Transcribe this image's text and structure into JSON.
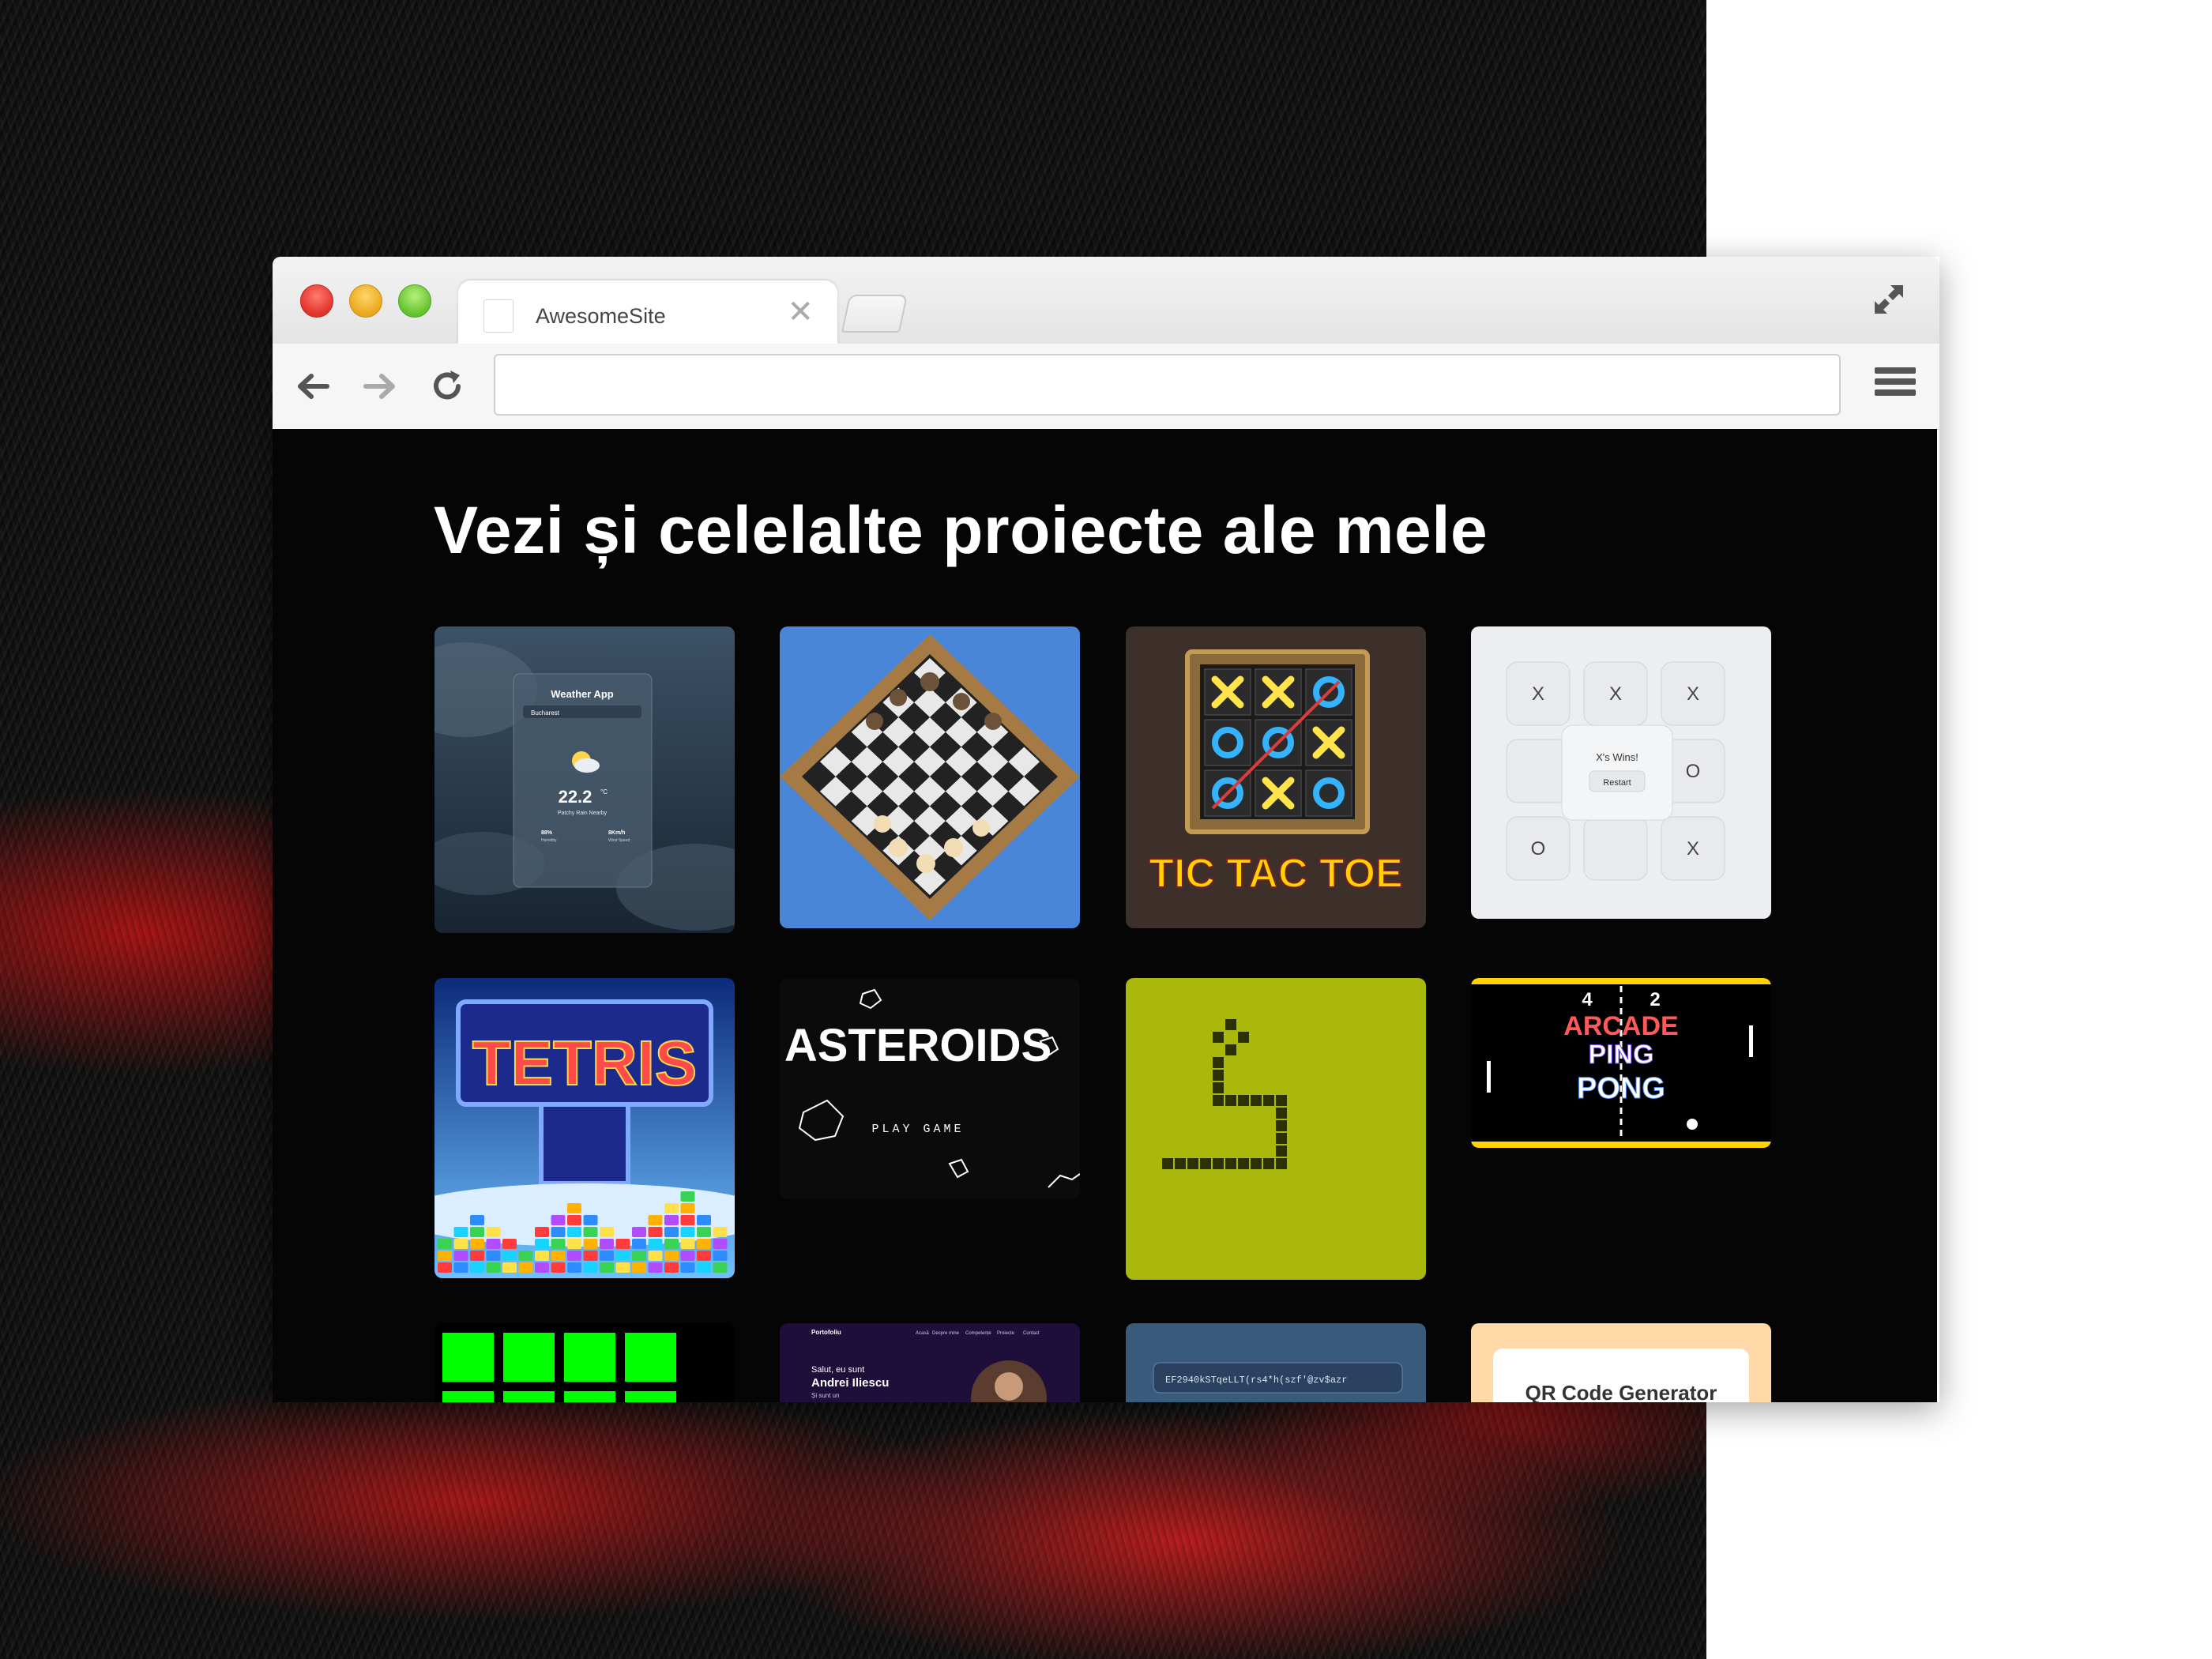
{
  "browser": {
    "tab_title": "AwesomeSite",
    "tab_close": "✕",
    "address_value": "",
    "address_placeholder": ""
  },
  "page": {
    "heading": "Vezi și celelalte proiecte ale mele"
  },
  "projects": [
    {
      "id": "weather",
      "icon": "weather-app-thumbnail",
      "title": "Weather App",
      "location": "Bucharest",
      "temperature": "22.2",
      "unit": "°C",
      "condition": "Patchy Rain Nearby",
      "humidity": "88%",
      "humidity_label": "Humidity",
      "wind": "8Km/h",
      "wind_label": "Wind Speed"
    },
    {
      "id": "chess",
      "icon": "chess-thumbnail"
    },
    {
      "id": "tictactoe",
      "icon": "tic-tac-toe-thumbnail",
      "title": "TIC TAC TOE",
      "board": [
        "X",
        "X",
        "O",
        "O",
        "O",
        "X",
        "O",
        "X",
        "O"
      ]
    },
    {
      "id": "tictactoe-neumorphic",
      "icon": "tic-tac-toe-neumorphic-thumbnail",
      "board": [
        "X",
        "X",
        "X",
        "",
        "",
        "O",
        "O",
        "",
        "X"
      ],
      "message": "X's Wins!",
      "restart": "Restart"
    },
    {
      "id": "tetris",
      "icon": "tetris-thumbnail",
      "title": "TETRIS"
    },
    {
      "id": "asteroids",
      "icon": "asteroids-thumbnail",
      "title": "ASTEROIDS",
      "cta": "PLAY GAME"
    },
    {
      "id": "snake",
      "icon": "snake-thumbnail"
    },
    {
      "id": "pingpong",
      "icon": "ping-pong-thumbnail",
      "score_left": "4",
      "score_right": "2",
      "line1": "ARCADE",
      "line2": "PING",
      "line3": "PONG"
    },
    {
      "id": "blocks",
      "icon": "green-blocks-thumbnail"
    },
    {
      "id": "portfolio",
      "icon": "portfolio-thumbnail",
      "brand": "Portofoliu",
      "nav": [
        "Acasă",
        "Despre mine",
        "Competențe",
        "Proiecte",
        "Contact"
      ],
      "greeting": "Salut, eu sunt",
      "name": "Andrei Iliescu",
      "sub": "Și sunt un"
    },
    {
      "id": "password",
      "icon": "password-generator-thumbnail",
      "value": "EF2940kSTqeLLT(rs4*h(szf'@zv$azr"
    },
    {
      "id": "qrcode",
      "icon": "qr-code-generator-thumbnail",
      "title": "QR Code Generator"
    }
  ],
  "colors": {
    "page_bg": "#050505",
    "heading": "#ffffff",
    "accent_red": "#e2322a",
    "accent_yellow": "#e9a71c",
    "accent_green": "#62c22e"
  }
}
